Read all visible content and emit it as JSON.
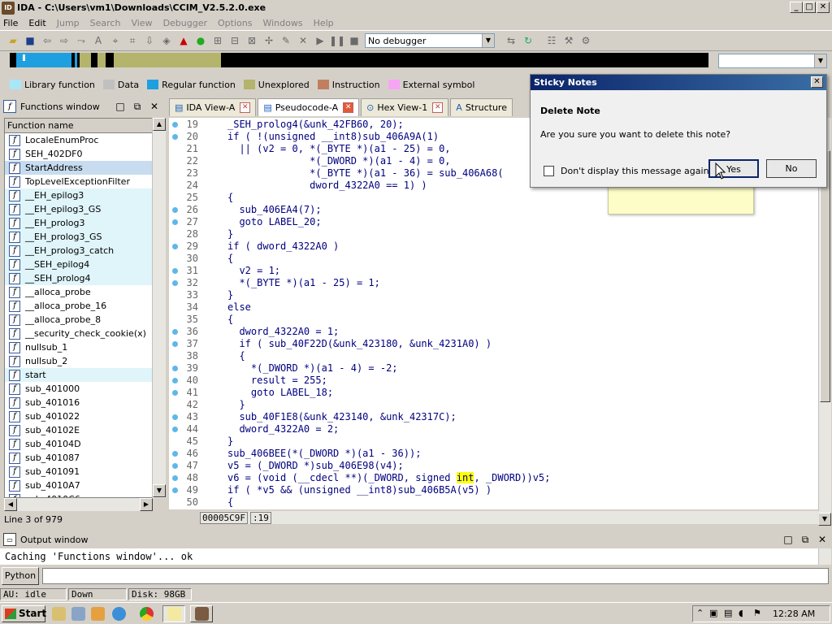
{
  "window": {
    "title": "IDA - C:\\Users\\vm1\\Downloads\\CCIM_V2.5.2.0.exe",
    "minimize": "_",
    "maximize": "□",
    "close": "✕"
  },
  "menu": [
    "File",
    "Edit",
    "Jump",
    "Search",
    "View",
    "Debugger",
    "Options",
    "Windows",
    "Help"
  ],
  "toolbar": {
    "debugger_select": "No debugger"
  },
  "legend": [
    {
      "label": "Library function",
      "color": "#a9e7f7"
    },
    {
      "label": "Data",
      "color": "#c0c0c0"
    },
    {
      "label": "Regular function",
      "color": "#1ea0e0"
    },
    {
      "label": "Unexplored",
      "color": "#b4b46c"
    },
    {
      "label": "Instruction",
      "color": "#c08060"
    },
    {
      "label": "External symbol",
      "color": "#f7a4f4"
    }
  ],
  "functions_window": {
    "title": "Functions window",
    "column": "Function name",
    "items": [
      "LocaleEnumProc",
      "SEH_402DF0",
      "StartAddress",
      "TopLevelExceptionFilter",
      "__EH_epilog3",
      "__EH_epilog3_GS",
      "__EH_prolog3",
      "__EH_prolog3_GS",
      "__EH_prolog3_catch",
      "__SEH_epilog4",
      "__SEH_prolog4",
      "__alloca_probe",
      "__alloca_probe_16",
      "__alloca_probe_8",
      "__security_check_cookie(x)",
      "nullsub_1",
      "nullsub_2",
      "start",
      "sub_401000",
      "sub_401016",
      "sub_401022",
      "sub_40102E",
      "sub_40104D",
      "sub_401087",
      "sub_401091",
      "sub_4010A7",
      "sub_4010C6"
    ],
    "status": "Line 3 of 979"
  },
  "tabs": [
    {
      "label": "IDA View-A"
    },
    {
      "label": "Pseudocode-A"
    },
    {
      "label": "Hex View-1"
    },
    {
      "label": "Structure"
    }
  ],
  "code": [
    {
      "n": "19",
      "d": true,
      "t": "_SEH_prolog4(&unk_42FB60, 20);"
    },
    {
      "n": "20",
      "d": true,
      "t": "if ( !(unsigned __int8)sub_406A9A(1)"
    },
    {
      "n": "21",
      "d": false,
      "t": "  || (v2 = 0, *(_BYTE *)(a1 - 25) = 0,"
    },
    {
      "n": "22",
      "d": false,
      "t": "              *(_DWORD *)(a1 - 4) = 0,"
    },
    {
      "n": "23",
      "d": false,
      "t": "              *(_BYTE *)(a1 - 36) = sub_406A68("
    },
    {
      "n": "24",
      "d": false,
      "t": "              dword_4322A0 == 1) )"
    },
    {
      "n": "25",
      "d": false,
      "t": "{"
    },
    {
      "n": "26",
      "d": true,
      "t": "  sub_406EA4(7);"
    },
    {
      "n": "27",
      "d": true,
      "t": "  goto LABEL_20;"
    },
    {
      "n": "28",
      "d": false,
      "t": "}"
    },
    {
      "n": "29",
      "d": true,
      "t": "if ( dword_4322A0 )"
    },
    {
      "n": "30",
      "d": false,
      "t": "{"
    },
    {
      "n": "31",
      "d": true,
      "t": "  v2 = 1;"
    },
    {
      "n": "32",
      "d": true,
      "t": "  *(_BYTE *)(a1 - 25) = 1;"
    },
    {
      "n": "33",
      "d": false,
      "t": "}"
    },
    {
      "n": "34",
      "d": false,
      "t": "else"
    },
    {
      "n": "35",
      "d": false,
      "t": "{"
    },
    {
      "n": "36",
      "d": true,
      "t": "  dword_4322A0 = 1;"
    },
    {
      "n": "37",
      "d": true,
      "t": "  if ( sub_40F22D(&unk_423180, &unk_4231A0) )"
    },
    {
      "n": "38",
      "d": false,
      "t": "  {"
    },
    {
      "n": "39",
      "d": true,
      "t": "    *(_DWORD *)(a1 - 4) = -2;"
    },
    {
      "n": "40",
      "d": true,
      "t": "    result = 255;"
    },
    {
      "n": "41",
      "d": true,
      "t": "    goto LABEL_18;"
    },
    {
      "n": "42",
      "d": false,
      "t": "  }"
    },
    {
      "n": "43",
      "d": true,
      "t": "  sub_40F1E8(&unk_423140, &unk_42317C);"
    },
    {
      "n": "44",
      "d": true,
      "t": "  dword_4322A0 = 2;"
    },
    {
      "n": "45",
      "d": false,
      "t": "}"
    },
    {
      "n": "46",
      "d": true,
      "t": "sub_406BEE(*(_DWORD *)(a1 - 36));"
    },
    {
      "n": "47",
      "d": true,
      "t": "v5 = (_DWORD *)sub_406E98(v4);"
    },
    {
      "n": "48",
      "d": true,
      "t": "v6 = (void (__cdecl **)(_DWORD, signed int, _DWORD))v5;"
    },
    {
      "n": "49",
      "d": true,
      "t": "if ( *v5 && (unsigned __int8)sub_406B5A(v5) )"
    },
    {
      "n": "50",
      "d": false,
      "t": "{"
    }
  ],
  "code_status": {
    "address": "00005C9F",
    "line": ":19"
  },
  "dialog": {
    "title": "Sticky Notes",
    "heading": "Delete Note",
    "message": "Are you sure you want to delete this note?",
    "checkbox": "Don't display this message again",
    "yes": "Yes",
    "no": "No"
  },
  "output": {
    "title": "Output window",
    "line": "Caching 'Functions window'... ok",
    "python_btn": "Python"
  },
  "status": {
    "au": "AU:  idle",
    "down": "Down",
    "disk": "Disk: 98GB"
  },
  "taskbar": {
    "start": "Start",
    "clock": "12:28 AM"
  }
}
